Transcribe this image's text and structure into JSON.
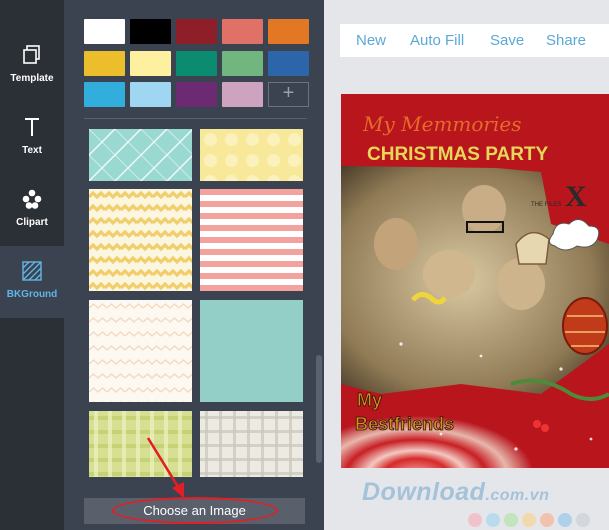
{
  "sidebar": {
    "tools": [
      {
        "label": "Template",
        "icon": "template-icon",
        "active": false
      },
      {
        "label": "Text",
        "icon": "text-icon",
        "active": false
      },
      {
        "label": "Clipart",
        "icon": "clipart-icon",
        "active": false
      },
      {
        "label": "BKGround",
        "icon": "background-icon",
        "active": true
      }
    ]
  },
  "panel": {
    "colors": [
      "#ffffff",
      "#000000",
      "#8e1f28",
      "#e07167",
      "#e37824",
      "#ecbe2c",
      "#fdf1a0",
      "#0b8b70",
      "#72b67f",
      "#2c65a9",
      "#32aedd",
      "#9fd6f1",
      "#6c2a72",
      "#cda3bf"
    ],
    "add_color_label": "+",
    "patterns": [
      "teal-diagonal-lines",
      "yellow-dots",
      "yellow-chevron",
      "pink-stripes",
      "cream-chevron",
      "teal-solid",
      "green-plaid",
      "gray-plaid"
    ],
    "choose_image_label": "Choose an Image"
  },
  "toolbar": {
    "new_label": "New",
    "auto_fill_label": "Auto Fill",
    "save_label": "Save",
    "share_label": "Share"
  },
  "card": {
    "script_title": "My Memmories",
    "title": "CHRISTMAS PARTY",
    "xfiles": "X",
    "files_text": "THE FILES",
    "line1": "My",
    "line2": "Bestfriends"
  },
  "watermark": {
    "text": "Download",
    "suffix": ".com.vn",
    "dot_colors": [
      "#f4b5c2",
      "#a9d8ee",
      "#b7e3b0",
      "#f6d49a",
      "#f7b59a",
      "#9fc9ea",
      "#cfd3d8"
    ]
  }
}
